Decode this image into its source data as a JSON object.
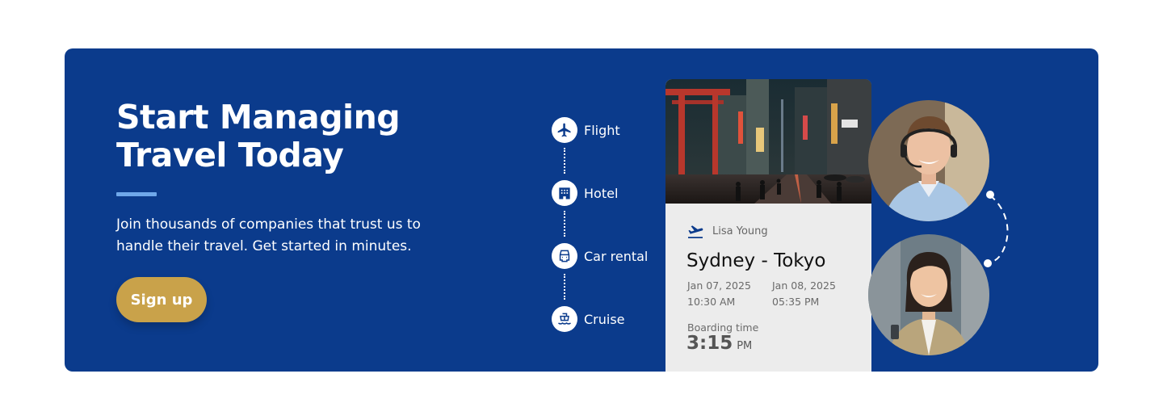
{
  "hero": {
    "title_line1": "Start Managing",
    "title_line2": "Travel Today",
    "subtitle_line1": "Join thousands of companies that trust us to",
    "subtitle_line2": "handle their travel. Get started in minutes.",
    "signup_label": "Sign up"
  },
  "services": [
    {
      "label": "Flight",
      "icon": "airplane-icon"
    },
    {
      "label": "Hotel",
      "icon": "hotel-icon"
    },
    {
      "label": "Car rental",
      "icon": "car-icon"
    },
    {
      "label": "Cruise",
      "icon": "ship-icon"
    }
  ],
  "ticket": {
    "passenger": "Lisa Young",
    "route": "Sydney - Tokyo",
    "departure_date": "Jan 07, 2025",
    "departure_time": "10:30 AM",
    "arrival_date": "Jan 08, 2025",
    "arrival_time": "05:35 PM",
    "boarding_label": "Boarding time",
    "boarding_time": "3:15",
    "boarding_period": "PM"
  },
  "colors": {
    "banner": "#0b3b8c",
    "accent_line": "#6fa8ea",
    "signup_button": "#c9a24a",
    "ticket_body": "#ececec",
    "icon_fill": "#0b3b8c"
  }
}
